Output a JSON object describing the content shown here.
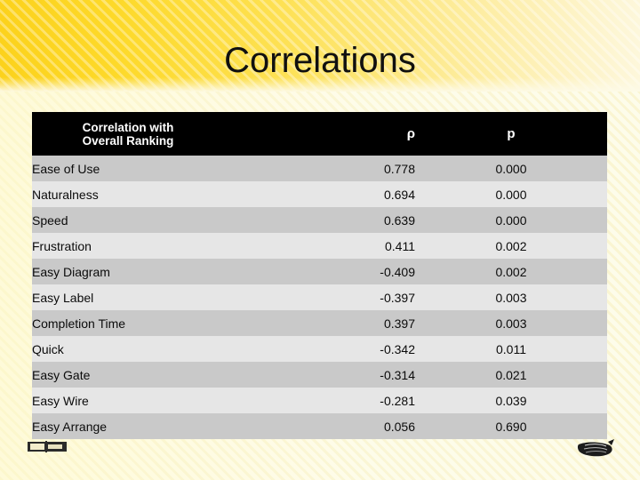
{
  "slide": {
    "title": "Correlations"
  },
  "table": {
    "headers": {
      "name_line1": "Correlation with",
      "name_line2": "Overall Ranking",
      "rho": "ρ",
      "p": "p"
    },
    "rows": [
      {
        "label": "Ease of Use",
        "rho": "0.778",
        "p": "0.000"
      },
      {
        "label": "Naturalness",
        "rho": "0.694",
        "p": "0.000"
      },
      {
        "label": "Speed",
        "rho": "0.639",
        "p": "0.000"
      },
      {
        "label": "Frustration",
        "rho": "0.411",
        "p": "0.002"
      },
      {
        "label": "Easy Diagram",
        "rho": "-0.409",
        "p": "0.002"
      },
      {
        "label": "Easy Label",
        "rho": "-0.397",
        "p": "0.003"
      },
      {
        "label": "Completion Time",
        "rho": "0.397",
        "p": "0.003"
      },
      {
        "label": "Quick",
        "rho": "-0.342",
        "p": "0.011"
      },
      {
        "label": "Easy Gate",
        "rho": "-0.314",
        "p": "0.021"
      },
      {
        "label": "Easy Wire",
        "rho": "-0.281",
        "p": "0.039"
      },
      {
        "label": "Easy Arrange",
        "rho": "0.056",
        "p": "0.690"
      }
    ]
  },
  "decorations": {
    "bottom_left": "bracket-ornament-icon",
    "bottom_right": "fan-swoosh-ornament-icon"
  },
  "colors": {
    "banner_start": "#fcd21c",
    "banner_end": "#fdf7db",
    "page_background": "#fdfbe7",
    "header_background": "#000000",
    "header_text": "#ffffff",
    "row_odd": "#c9c9c9",
    "row_even": "#e6e6e6",
    "body_text": "#0b0b0b"
  }
}
